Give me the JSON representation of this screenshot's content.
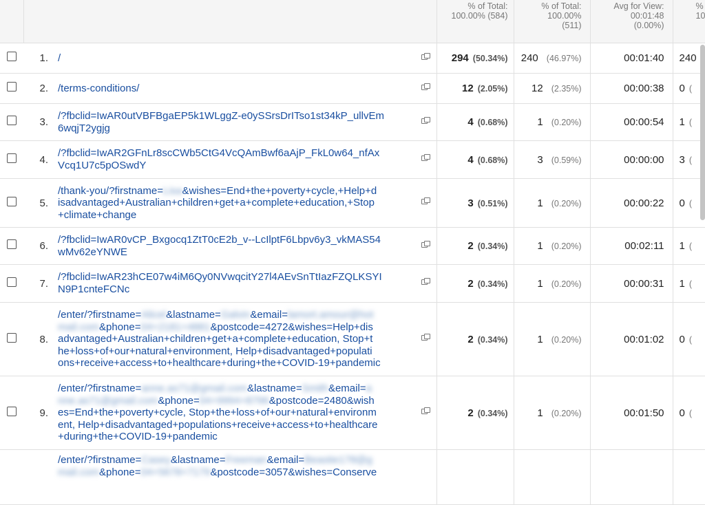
{
  "header": {
    "pageviews_total": "% of Total:",
    "pageviews_total_value": "100.00% (584)",
    "unique_total": "% of Total:",
    "unique_total_value": "100.00%",
    "unique_total_count": "(511)",
    "avg_label": "Avg for View:",
    "avg_value": "00:01:48",
    "avg_pct": "(0.00%)",
    "entrances_total": "% of",
    "entrances_total_value": "10"
  },
  "rows": [
    {
      "index": "1.",
      "page_lines": [
        "/"
      ],
      "pageviews": "294",
      "pageviews_pct": "(50.34%)",
      "unique": "240",
      "unique_pct": "(46.97%)",
      "avg_time": "00:01:40",
      "entrances": "240",
      "entrances_pct": "(4"
    },
    {
      "index": "2.",
      "page_lines": [
        "/terms-conditions/"
      ],
      "pageviews": "12",
      "pageviews_pct": "(2.05%)",
      "unique": "12",
      "unique_pct": "(2.35%)",
      "avg_time": "00:00:38",
      "entrances": "0",
      "entrances_pct": "("
    },
    {
      "index": "3.",
      "page_lines": [
        "/?fbclid=IwAR0utVBFBgaEP5k1WLggZ-e0ySSrsDrITso1st34kP_ullvEm",
        "6wqjT2ygjg"
      ],
      "pageviews": "4",
      "pageviews_pct": "(0.68%)",
      "unique": "1",
      "unique_pct": "(0.20%)",
      "avg_time": "00:00:54",
      "entrances": "1",
      "entrances_pct": "("
    },
    {
      "index": "4.",
      "page_lines": [
        "/?fbclid=IwAR2GFnLr8scCWb5CtG4VcQAmBwf6aAjP_FkL0w64_nfAx",
        "Vcq1U7c5pOSwdY"
      ],
      "pageviews": "4",
      "pageviews_pct": "(0.68%)",
      "unique": "3",
      "unique_pct": "(0.59%)",
      "avg_time": "00:00:00",
      "entrances": "3",
      "entrances_pct": "("
    },
    {
      "index": "5.",
      "page_lines": [
        "/thank-you/?firstname=",
        "&wishes=End+the+poverty+cycle,+Help+d",
        "isadvantaged+Australian+children+get+a+complete+education,+Stop",
        "+climate+change"
      ],
      "pageviews": "3",
      "pageviews_pct": "(0.51%)",
      "unique": "1",
      "unique_pct": "(0.20%)",
      "avg_time": "00:00:22",
      "entrances": "0",
      "entrances_pct": "("
    },
    {
      "index": "6.",
      "page_lines": [
        "/?fbclid=IwAR0vCP_Bxgocq1ZtT0cE2b_v--LcIlptF6Lbpv6y3_vkMAS54",
        "wMv62eYNWE"
      ],
      "pageviews": "2",
      "pageviews_pct": "(0.34%)",
      "unique": "1",
      "unique_pct": "(0.20%)",
      "avg_time": "00:02:11",
      "entrances": "1",
      "entrances_pct": "("
    },
    {
      "index": "7.",
      "page_lines": [
        "/?fbclid=IwAR23hCE07w4iM6Qy0NVwqcitY27l4AEvSnTtIazFZQLKSYI",
        "N9P1cnteFCNc"
      ],
      "pageviews": "2",
      "pageviews_pct": "(0.34%)",
      "unique": "1",
      "unique_pct": "(0.20%)",
      "avg_time": "00:00:31",
      "entrances": "1",
      "entrances_pct": "("
    },
    {
      "index": "8.",
      "page_lines": [
        "/enter/?firstname=",
        "&lastname=",
        "&email=",
        "&phone=",
        "&postcode=4272&wishes=Help+dis",
        "advantaged+Australian+children+get+a+complete+education, Stop+t",
        "he+loss+of+our+natural+environment, Help+disadvantaged+populati",
        "ons+receive+access+to+healthcare+during+the+COVID-19+pandemic"
      ],
      "pageviews": "2",
      "pageviews_pct": "(0.34%)",
      "unique": "1",
      "unique_pct": "(0.20%)",
      "avg_time": "00:01:02",
      "entrances": "0",
      "entrances_pct": "("
    },
    {
      "index": "9.",
      "page_lines": [
        "/enter/?firstname=",
        "&lastname=",
        "&email=",
        "&phone=",
        "&postcode=2480&wish",
        "es=End+the+poverty+cycle, Stop+the+loss+of+our+natural+environm",
        "ent, Help+disadvantaged+populations+receive+access+to+healthcare",
        "+during+the+COVID-19+pandemic"
      ],
      "pageviews": "2",
      "pageviews_pct": "(0.34%)",
      "unique": "1",
      "unique_pct": "(0.20%)",
      "avg_time": "00:01:50",
      "entrances": "0",
      "entrances_pct": "("
    },
    {
      "index": "10.",
      "page_lines": [
        "/enter/?firstname=",
        "&lastname=",
        "&email=",
        "&phone=",
        "&postcode=3057&wishes=Conserve"
      ],
      "pageviews": "",
      "pageviews_pct": "",
      "unique": "",
      "unique_pct": "",
      "avg_time": "",
      "entrances": "",
      "entrances_pct": ""
    }
  ]
}
